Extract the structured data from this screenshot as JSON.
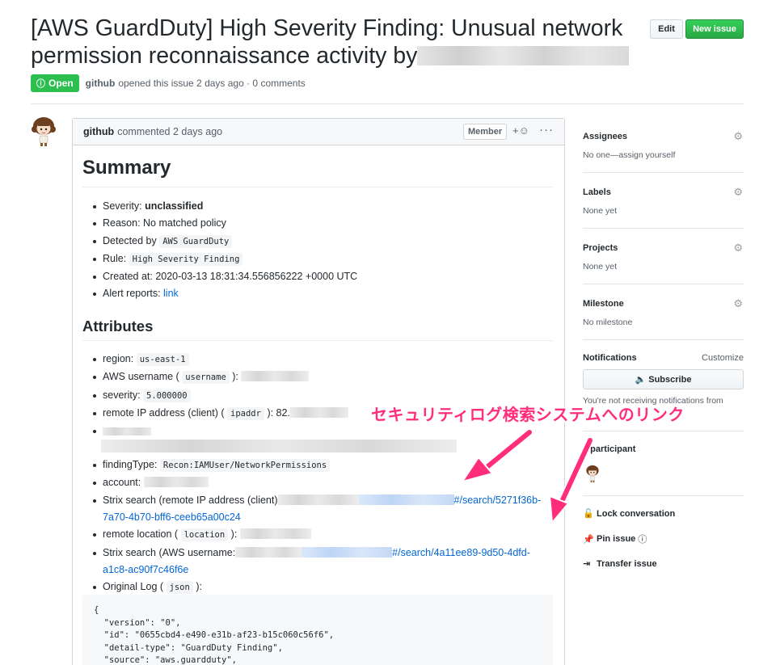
{
  "issue": {
    "title": "[AWS GuardDuty] High Severity Finding: Unusual network permission reconnaissance activity by",
    "state_label": "Open",
    "author": "github",
    "meta": "opened this issue 2 days ago · 0 comments"
  },
  "toolbar": {
    "edit_label": "Edit",
    "new_issue_label": "New issue"
  },
  "comment": {
    "author": "github",
    "meta": "commented 2 days ago",
    "badge": "Member",
    "summary_heading": "Summary",
    "summary": [
      {
        "label": "Severity: ",
        "value": "unclassified"
      },
      {
        "label": "Reason: ",
        "value": "No matched policy"
      },
      {
        "label": "Detected by ",
        "code": "AWS GuardDuty"
      },
      {
        "label": "Rule: ",
        "code": "High Severity Finding"
      },
      {
        "label": "Created at: ",
        "value": "2020-03-13 18:31:34.556856222 +0000 UTC"
      },
      {
        "label": "Alert reports: ",
        "link": "link"
      }
    ],
    "attributes_heading": "Attributes",
    "attributes": {
      "region_label": "region: ",
      "region": "us-east-1",
      "aws_username_label": "AWS username (",
      "aws_username_code": "username",
      "aws_username_suffix": "):",
      "severity_label": "severity: ",
      "severity": "5.000000",
      "remote_ip_label": "remote IP address (client) (",
      "remote_ip_code": "ipaddr",
      "remote_ip_suffix": "): 82.",
      "finding_type_label": "findingType: ",
      "finding_type": "Recon:IAMUser/NetworkPermissions",
      "account_label": "account: ",
      "strix_ip_label": "Strix search (remote IP address (client)",
      "strix_ip_link_a": "#/search/5271f36b-",
      "strix_ip_link_b": "7a70-4b70-bff6-ceeb65a00c24",
      "remote_location_label": "remote location (",
      "remote_location_code": "location",
      "remote_location_suffix": "):",
      "strix_user_label": "Strix search (AWS username:",
      "strix_user_link_a": "#/search/4a11ee89-9d50-4dfd-",
      "strix_user_link_b": "a1c8-ac90f7c46f6e",
      "original_log_label": "Original Log (",
      "original_log_code": "json",
      "original_log_suffix": "):"
    },
    "json_lines": [
      "{",
      "  \"version\": \"0\",",
      "  \"id\": \"0655cbd4-e490-e31b-af23-b15c060c56f6\",",
      "  \"detail-type\": \"GuardDuty Finding\",",
      "  \"source\": \"aws.guardduty\","
    ]
  },
  "sidebar": {
    "assignees": {
      "title": "Assignees",
      "value": "No one—assign yourself"
    },
    "labels": {
      "title": "Labels",
      "value": "None yet"
    },
    "projects": {
      "title": "Projects",
      "value": "None yet"
    },
    "milestone": {
      "title": "Milestone",
      "value": "No milestone"
    },
    "notifications": {
      "title": "Notifications",
      "customize": "Customize",
      "subscribe": "Subscribe",
      "note": "You're not receiving notifications from"
    },
    "participants": "1 participant",
    "actions": {
      "lock": "Lock conversation",
      "pin": "Pin issue",
      "transfer": "Transfer issue"
    }
  },
  "annotation": {
    "text": "セキュリティログ検索システムへのリンク",
    "color": "#ff2d7a"
  },
  "colors": {
    "open": "#2cbe4e",
    "link": "#0366d6",
    "new_issue": "#28a745"
  },
  "icons": [
    "gear-icon",
    "smiley-icon",
    "kebab-icon",
    "lock-icon",
    "pin-icon",
    "transfer-icon",
    "speaker-icon",
    "info-icon",
    "issue-opened-icon"
  ]
}
